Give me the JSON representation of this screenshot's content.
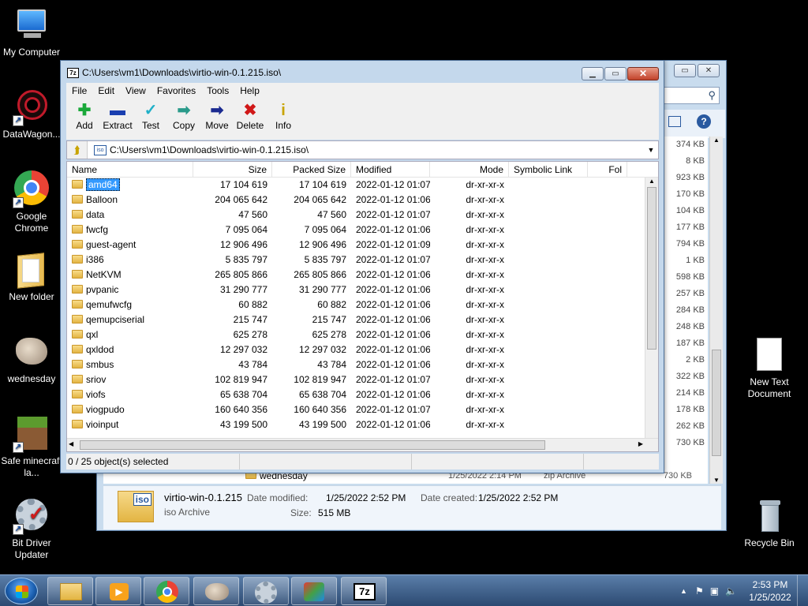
{
  "desktop": {
    "icons": [
      {
        "label": "My Computer"
      },
      {
        "label": "DataWagon..."
      },
      {
        "label": "Google Chrome"
      },
      {
        "label": "New folder"
      },
      {
        "label": "wednesday"
      },
      {
        "label": "Safe minecraft la..."
      },
      {
        "label": "Bit Driver Updater"
      },
      {
        "label": "New Text Document"
      },
      {
        "label": "Recycle Bin"
      }
    ]
  },
  "explorer": {
    "size_column": [
      "374 KB",
      "8 KB",
      "923 KB",
      "170 KB",
      "104 KB",
      "177 KB",
      "794 KB",
      "1 KB",
      "598 KB",
      "257 KB",
      "284 KB",
      "248 KB",
      "187 KB",
      "2 KB",
      "322 KB",
      "214 KB",
      "178 KB",
      "262 KB",
      "730 KB"
    ],
    "bottom_row": {
      "name": "wednesday",
      "date": "1/25/2022 2:14 PM",
      "type": "zip Archive",
      "size": "730 KB"
    },
    "details": {
      "file_name": "virtio-win-0.1.215",
      "file_type": "iso Archive",
      "date_modified_label": "Date modified:",
      "date_modified": "1/25/2022 2:52 PM",
      "date_created_label": "Date created:",
      "date_created": "1/25/2022 2:52 PM",
      "size_label": "Size:",
      "size": "515 MB",
      "icon_text": "iso"
    }
  },
  "sevenzip": {
    "title": "C:\\Users\\vm1\\Downloads\\virtio-win-0.1.215.iso\\",
    "icon_text": "7z",
    "menu": [
      "File",
      "Edit",
      "View",
      "Favorites",
      "Tools",
      "Help"
    ],
    "tools": [
      {
        "label": "Add",
        "glyph": "✚",
        "color": "#1aa83a"
      },
      {
        "label": "Extract",
        "glyph": "▬",
        "color": "#1a3fb0"
      },
      {
        "label": "Test",
        "glyph": "✓",
        "color": "#20b0c8"
      },
      {
        "label": "Copy",
        "glyph": "➡",
        "color": "#2a9a8a"
      },
      {
        "label": "Move",
        "glyph": "➡",
        "color": "#1a2a90"
      },
      {
        "label": "Delete",
        "glyph": "✖",
        "color": "#d01818"
      },
      {
        "label": "Info",
        "glyph": "i",
        "color": "#c8a400"
      }
    ],
    "address": "C:\\Users\\vm1\\Downloads\\virtio-win-0.1.215.iso\\",
    "columns": {
      "name": "Name",
      "size": "Size",
      "packed": "Packed Size",
      "modified": "Modified",
      "mode": "Mode",
      "symlink": "Symbolic Link",
      "folders": "Fol"
    },
    "rows": [
      {
        "name": "amd64",
        "size": "17 104 619",
        "packed": "17 104 619",
        "modified": "2022-01-12 01:07",
        "mode": "dr-xr-xr-x",
        "selected": true
      },
      {
        "name": "Balloon",
        "size": "204 065 642",
        "packed": "204 065 642",
        "modified": "2022-01-12 01:06",
        "mode": "dr-xr-xr-x"
      },
      {
        "name": "data",
        "size": "47 560",
        "packed": "47 560",
        "modified": "2022-01-12 01:07",
        "mode": "dr-xr-xr-x"
      },
      {
        "name": "fwcfg",
        "size": "7 095 064",
        "packed": "7 095 064",
        "modified": "2022-01-12 01:06",
        "mode": "dr-xr-xr-x"
      },
      {
        "name": "guest-agent",
        "size": "12 906 496",
        "packed": "12 906 496",
        "modified": "2022-01-12 01:09",
        "mode": "dr-xr-xr-x"
      },
      {
        "name": "i386",
        "size": "5 835 797",
        "packed": "5 835 797",
        "modified": "2022-01-12 01:07",
        "mode": "dr-xr-xr-x"
      },
      {
        "name": "NetKVM",
        "size": "265 805 866",
        "packed": "265 805 866",
        "modified": "2022-01-12 01:06",
        "mode": "dr-xr-xr-x"
      },
      {
        "name": "pvpanic",
        "size": "31 290 777",
        "packed": "31 290 777",
        "modified": "2022-01-12 01:06",
        "mode": "dr-xr-xr-x"
      },
      {
        "name": "qemufwcfg",
        "size": "60 882",
        "packed": "60 882",
        "modified": "2022-01-12 01:06",
        "mode": "dr-xr-xr-x"
      },
      {
        "name": "qemupciserial",
        "size": "215 747",
        "packed": "215 747",
        "modified": "2022-01-12 01:06",
        "mode": "dr-xr-xr-x"
      },
      {
        "name": "qxl",
        "size": "625 278",
        "packed": "625 278",
        "modified": "2022-01-12 01:06",
        "mode": "dr-xr-xr-x"
      },
      {
        "name": "qxldod",
        "size": "12 297 032",
        "packed": "12 297 032",
        "modified": "2022-01-12 01:06",
        "mode": "dr-xr-xr-x"
      },
      {
        "name": "smbus",
        "size": "43 784",
        "packed": "43 784",
        "modified": "2022-01-12 01:06",
        "mode": "dr-xr-xr-x"
      },
      {
        "name": "sriov",
        "size": "102 819 947",
        "packed": "102 819 947",
        "modified": "2022-01-12 01:07",
        "mode": "dr-xr-xr-x"
      },
      {
        "name": "viofs",
        "size": "65 638 704",
        "packed": "65 638 704",
        "modified": "2022-01-12 01:06",
        "mode": "dr-xr-xr-x"
      },
      {
        "name": "viogpudo",
        "size": "160 640 356",
        "packed": "160 640 356",
        "modified": "2022-01-12 01:07",
        "mode": "dr-xr-xr-x"
      },
      {
        "name": "vioinput",
        "size": "43 199 500",
        "packed": "43 199 500",
        "modified": "2022-01-12 01:06",
        "mode": "dr-xr-xr-x"
      }
    ],
    "status": "0 / 25 object(s) selected"
  },
  "taskbar": {
    "clock_time": "2:53 PM",
    "clock_date": "1/25/2022",
    "apps": [
      "windows-explorer",
      "media-player",
      "google-chrome",
      "wednesday",
      "bit-driver-updater",
      "safe-app",
      "7-zip"
    ]
  }
}
